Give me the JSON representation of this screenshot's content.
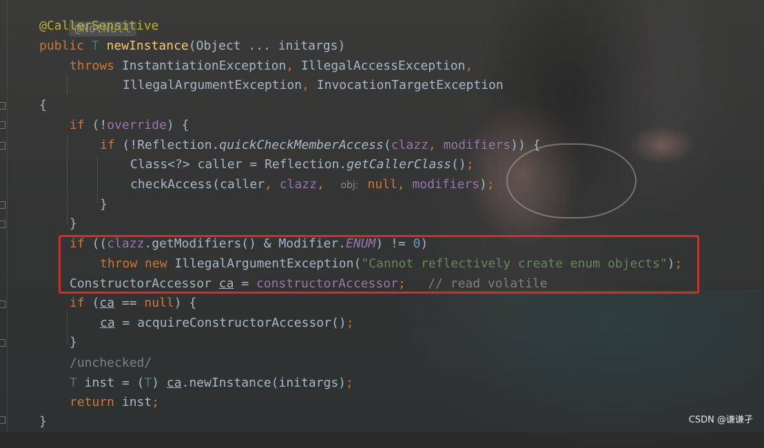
{
  "editor": {
    "line1_chip": "@NotNull",
    "line2_annotation": "@CallerSensitive",
    "line3": {
      "public": "public",
      "T": "T",
      "name": "newInstance",
      "params": "(Object ... initargs)"
    },
    "line4": {
      "throws": "throws",
      "a": "InstantiationException",
      "comma1": ",",
      "b": "IllegalAccessException",
      "comma2": ","
    },
    "line5": {
      "c": "IllegalArgumentException",
      "comma": ",",
      "d": "InvocationTargetException"
    },
    "line6": "{",
    "line7": {
      "if": "if",
      "p1": "(!",
      "override": "override",
      "p2": ") {"
    },
    "line8": {
      "if": "if",
      "p1": "(!Reflection.",
      "method": "quickCheckMemberAccess",
      "p2": "(",
      "clazz": "clazz",
      "comma": ",",
      "modifiers": "modifiers",
      "p3": ")) {"
    },
    "line9": {
      "p1": "Class<?> caller = Reflection.",
      "method": "getCallerClass",
      "p2": "()",
      "semi": ";"
    },
    "line10": {
      "p1": "checkAccess(caller",
      "comma1": ",",
      "clazz": "clazz",
      "comma2": ",",
      "hint": "obj:",
      "null": "null",
      "comma3": ",",
      "modifiers": "modifiers",
      "p2": ")",
      "semi": ";"
    },
    "line11": "}",
    "line12": "}",
    "line13": {
      "if": "if",
      "p1": "((",
      "clazz": "clazz",
      "p2": ".getModifiers() & Modifier.",
      "enum": "ENUM",
      "p3": ") != ",
      "zero": "0",
      "p4": ")"
    },
    "line14": {
      "throw": "throw",
      "new": "new",
      "p1": "IllegalArgumentException(",
      "str": "\"Cannot reflectively create enum objects\"",
      "p2": ")",
      "semi": ";"
    },
    "line15": {
      "p1": "ConstructorAccessor",
      "ca": "ca",
      "p2": " = ",
      "field": "constructorAccessor",
      "semi": ";",
      "comment": "// read volatile"
    },
    "line16": {
      "if": "if",
      "p1": "(",
      "ca": "ca",
      "p2": " == ",
      "null": "null",
      "p3": ") {"
    },
    "line17": {
      "ca": "ca",
      "p1": " = acquireConstructorAccessor()",
      "semi": ";"
    },
    "line18": "}",
    "line19": "/unchecked/",
    "line20": {
      "T1": "T",
      "p1": " inst = (",
      "T2": "T",
      "p2": ") ",
      "ca": "ca",
      "p3": ".newInstance(initargs)",
      "semi": ";"
    },
    "line21": {
      "return": "return",
      "p1": " inst",
      "semi": ";"
    },
    "line22": "}"
  },
  "watermark": "CSDN @谦谦孑",
  "colors": {
    "keyword": "#cc7832",
    "annotation": "#bbb529",
    "method_decl": "#ffc66d",
    "field": "#9876aa",
    "string": "#6a8759",
    "number": "#6897bb",
    "comment": "#808080",
    "highlight_box": "#e0291f"
  }
}
